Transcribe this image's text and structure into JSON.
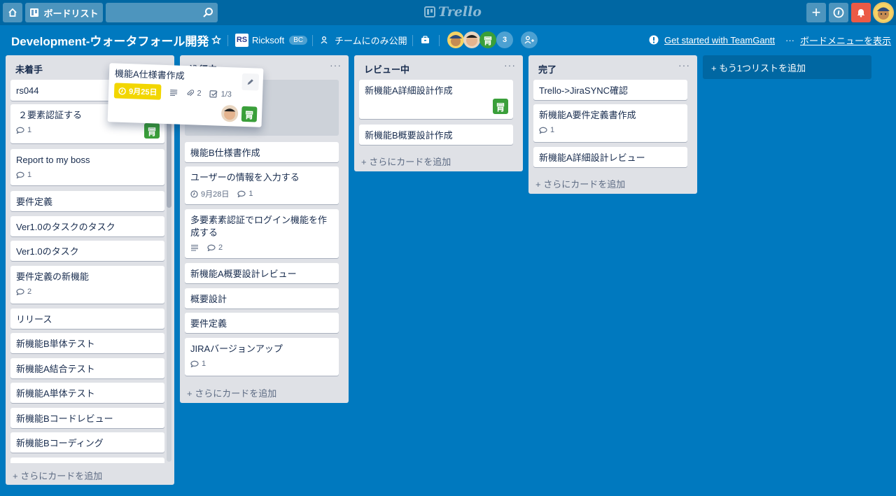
{
  "topbar": {
    "home_icon": "home-icon",
    "boards_label": "ボードリスト",
    "search_value": "",
    "search_placeholder": "",
    "logo_text": "Trello",
    "add_icon": "+",
    "info_icon": "i",
    "notification_icon": "bell-icon"
  },
  "board": {
    "title": "Development-ウォータフォール開発",
    "team_name": "Ricksoft",
    "team_badge": "BC",
    "visibility": "チームにのみ公開",
    "members_extra_count": "3",
    "teamgantt_link": "Get started with TeamGantt",
    "menu_link": "ボードメニューを表示",
    "menu_dots": "···"
  },
  "lists": [
    {
      "title": "未着手",
      "menu": "···",
      "add_card": "+ さらにカードを追加",
      "cards": [
        {
          "title": "rs044"
        },
        {
          "title": "２要素認証する",
          "comments": "1"
        },
        {
          "title": "Report to my boss",
          "comments": "1"
        },
        {
          "title": "要件定義"
        },
        {
          "title": "Ver1.0のタスクのタスク"
        },
        {
          "title": "Ver1.0のタスク"
        },
        {
          "title": "要件定義の新機能",
          "comments": "2"
        },
        {
          "title": "リリース"
        },
        {
          "title": "新機能B単体テスト"
        },
        {
          "title": "新機能A結合テスト"
        },
        {
          "title": "新機能A単体テスト"
        },
        {
          "title": "新機能Bコードレビュー"
        },
        {
          "title": "新機能Bコーディング"
        }
      ]
    },
    {
      "title": "進行中",
      "menu": "···",
      "add_card": "+ さらにカードを追加",
      "cards": [
        {
          "title": "機能B仕様書作成"
        },
        {
          "title": "ユーザーの情報を入力する",
          "due": "9月28日",
          "comments": "1"
        },
        {
          "title": "多要素素認証でログイン機能を作成する",
          "comments": "2"
        },
        {
          "title": "新機能A概要設計レビュー"
        },
        {
          "title": "概要設計"
        },
        {
          "title": "要件定義"
        },
        {
          "title": "JIRAバージョンアップ",
          "comments": "1"
        }
      ]
    },
    {
      "title": "レビュー中",
      "menu": "···",
      "add_card": "+ さらにカードを追加",
      "cards": [
        {
          "title": "新機能A詳細設計作成"
        },
        {
          "title": "新機能B概要設計作成"
        }
      ]
    },
    {
      "title": "完了",
      "menu": "···",
      "add_card": "+ さらにカードを追加",
      "cards": [
        {
          "title": "Trello->JiraSYNC確認"
        },
        {
          "title": "新機能A要件定義書作成",
          "comments": "1"
        },
        {
          "title": "新機能A詳細設計レビュー"
        }
      ]
    }
  ],
  "add_list": "+ もう1つリストを追加",
  "dragging_card": {
    "title": "機能A仕様書作成",
    "due": "9月25日",
    "attachments": "2",
    "checklist": "1/3"
  },
  "colors": {
    "board_bg": "#0079bf",
    "topbar_bg": "#0067a3",
    "due_badge": "#f2d600",
    "notification": "#eb5a46",
    "member_green": "#3a9f3a"
  }
}
